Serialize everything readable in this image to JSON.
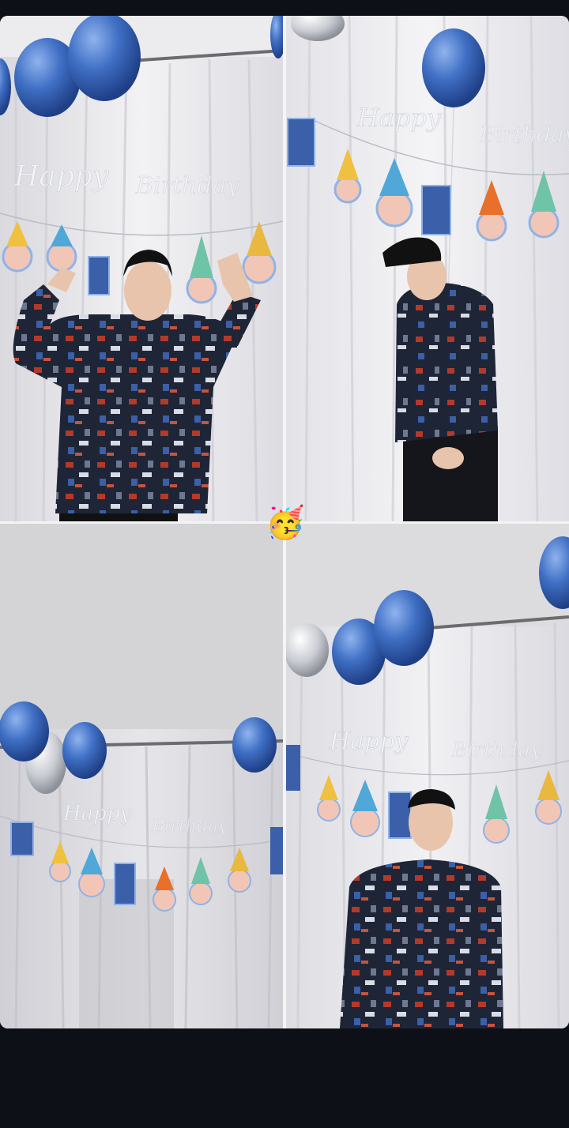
{
  "banner": {
    "line1": "Happy",
    "line2": "Birthday"
  },
  "sticker": {
    "emoji": "🥳",
    "icon": "partying-face-icon"
  },
  "colors": {
    "background": "#0d1117",
    "balloon_blue": "#3f6fc4",
    "balloon_silver": "#c9ccd2",
    "curtain": "#e9e9ec",
    "sweater": "#1e2536"
  }
}
